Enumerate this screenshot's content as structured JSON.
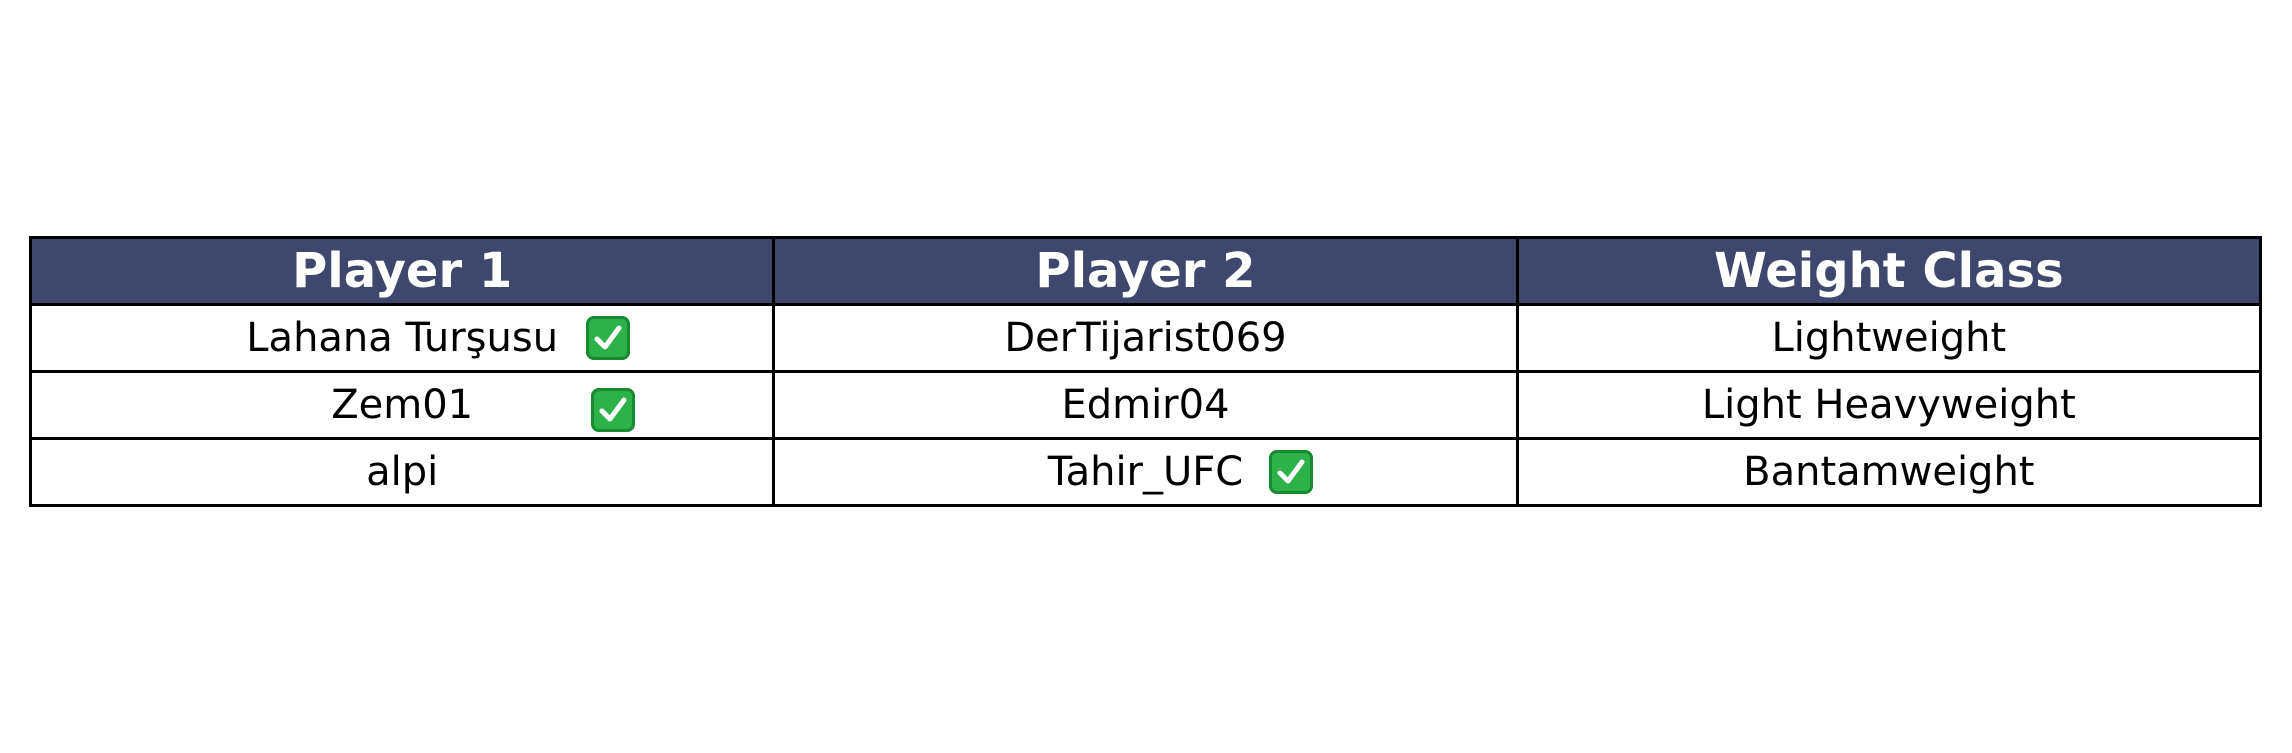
{
  "table": {
    "headers": [
      "Player 1",
      "Player 2",
      "Weight Class"
    ],
    "rows": [
      {
        "player1": {
          "name": "Lahana Turşusu",
          "confirmed": true
        },
        "player2": {
          "name": "DerTijarist069",
          "confirmed": false
        },
        "weight_class": "Lightweight"
      },
      {
        "player1": {
          "name": "Zem01",
          "confirmed": true
        },
        "player2": {
          "name": "Edmir04",
          "confirmed": false
        },
        "weight_class": "Light Heavyweight"
      },
      {
        "player1": {
          "name": "alpi",
          "confirmed": false
        },
        "player2": {
          "name": "Tahir_UFC",
          "confirmed": true
        },
        "weight_class": "Bantamweight"
      }
    ]
  },
  "icons": {
    "confirmed": "check-mark-button-icon"
  },
  "colors": {
    "header_bg": "#40476d",
    "header_text": "#ffffff",
    "border": "#000000",
    "check_bg": "#2db24a"
  }
}
